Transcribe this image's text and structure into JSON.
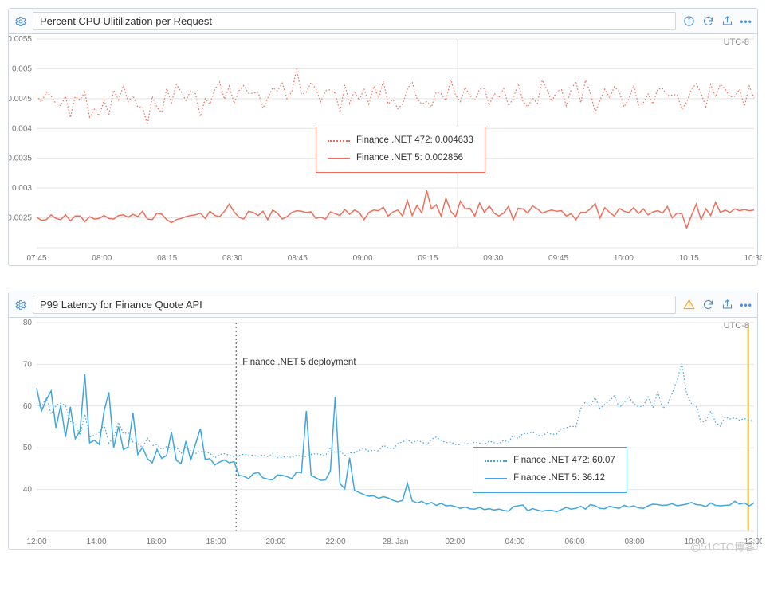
{
  "watermark": "@51CTO博客",
  "panels": [
    {
      "title": "Percent CPU Ulitilization per Request",
      "tz": "UTC-8",
      "icons": {
        "lead": "info-icon",
        "warn": false
      },
      "legend": {
        "series472": "Finance .NET 472: 0.004633",
        "series5": "Finance .NET 5: 0.002856",
        "color": "#ef6e5a",
        "box_border": "#ef6e5a",
        "left_pct": 41,
        "top_pct": 40
      },
      "cursor_x_frac": 0.587
    },
    {
      "title": "P99 Latency for Finance Quote API",
      "tz": "UTC-8",
      "icons": {
        "lead": "warning-icon",
        "warn": true
      },
      "legend": {
        "series472": "Finance .NET 472: 60.07",
        "series5": "Finance .NET 5: 36.12",
        "color": "#3fa6e0",
        "box_border": "#3fa6e0",
        "left_pct": 62,
        "top_pct": 56
      },
      "annotation": {
        "label": "Finance .NET 5 deployment",
        "x_frac": 0.278
      },
      "yellow_marker_x_frac": 0.992
    }
  ],
  "chart_data": [
    {
      "type": "line",
      "title": "Percent CPU Ulitilization per Request",
      "xlabel": "",
      "ylabel": "",
      "ylim": [
        0.002,
        0.0055
      ],
      "y_ticks": [
        0.0025,
        0.003,
        0.0035,
        0.004,
        0.0045,
        0.005,
        0.0055
      ],
      "x_ticks": [
        "07:45",
        "08:00",
        "08:15",
        "08:30",
        "08:45",
        "09:00",
        "09:15",
        "09:30",
        "09:45",
        "10:00",
        "10:15",
        "10:30"
      ],
      "series": [
        {
          "name": "Finance .NET 472",
          "style": "dotted",
          "color": "#ef6e5a",
          "values": [
            0.00455,
            0.00444,
            0.00461,
            0.00454,
            0.00442,
            0.00438,
            0.00454,
            0.00418,
            0.00454,
            0.00448,
            0.00461,
            0.00419,
            0.00432,
            0.00421,
            0.00448,
            0.00423,
            0.00464,
            0.00448,
            0.00472,
            0.00445,
            0.00455,
            0.00436,
            0.00436,
            0.00406,
            0.00454,
            0.00435,
            0.00427,
            0.00467,
            0.00443,
            0.00474,
            0.00462,
            0.00447,
            0.00463,
            0.00458,
            0.0042,
            0.0045,
            0.00441,
            0.00465,
            0.00478,
            0.00449,
            0.00471,
            0.00442,
            0.00463,
            0.00472,
            0.00459,
            0.00459,
            0.00461,
            0.00434,
            0.00451,
            0.00468,
            0.00463,
            0.00476,
            0.0045,
            0.00462,
            0.005,
            0.00457,
            0.00461,
            0.00477,
            0.00466,
            0.00445,
            0.00463,
            0.00465,
            0.00459,
            0.00427,
            0.00473,
            0.00442,
            0.00463,
            0.00447,
            0.00467,
            0.00441,
            0.00471,
            0.00451,
            0.00479,
            0.00441,
            0.00449,
            0.00433,
            0.00441,
            0.00466,
            0.00478,
            0.00449,
            0.00441,
            0.00445,
            0.00436,
            0.00461,
            0.00458,
            0.00447,
            0.00482,
            0.00456,
            0.00445,
            0.00469,
            0.00455,
            0.00447,
            0.00466,
            0.00467,
            0.00439,
            0.00459,
            0.00452,
            0.00467,
            0.00438,
            0.0045,
            0.00476,
            0.00446,
            0.00436,
            0.00451,
            0.00442,
            0.00481,
            0.00465,
            0.00445,
            0.00462,
            0.00465,
            0.00438,
            0.00465,
            0.00479,
            0.00443,
            0.00481,
            0.0046,
            0.00427,
            0.00447,
            0.00466,
            0.00451,
            0.0047,
            0.00462,
            0.00436,
            0.0045,
            0.00472,
            0.00439,
            0.00443,
            0.00458,
            0.00441,
            0.00466,
            0.00467,
            0.00455,
            0.00456,
            0.00457,
            0.00432,
            0.00444,
            0.00466,
            0.00475,
            0.00459,
            0.00436,
            0.00474,
            0.00453,
            0.00474,
            0.00466,
            0.00453,
            0.00454,
            0.00466,
            0.00437,
            0.00471,
            0.00451
          ]
        },
        {
          "name": "Finance .NET 5",
          "style": "solid",
          "color": "#ef6e5a",
          "values": [
            0.00251,
            0.00246,
            0.00247,
            0.00255,
            0.00249,
            0.00247,
            0.00255,
            0.00245,
            0.00253,
            0.00253,
            0.00244,
            0.00252,
            0.00248,
            0.00249,
            0.00254,
            0.00249,
            0.00248,
            0.00254,
            0.00255,
            0.00251,
            0.00256,
            0.00252,
            0.00261,
            0.00248,
            0.00247,
            0.00258,
            0.00256,
            0.00247,
            0.00242,
            0.00247,
            0.00249,
            0.00252,
            0.00254,
            0.00255,
            0.00258,
            0.00249,
            0.00261,
            0.00254,
            0.00252,
            0.00261,
            0.00273,
            0.0026,
            0.00251,
            0.00248,
            0.00261,
            0.00259,
            0.00254,
            0.00261,
            0.00247,
            0.00263,
            0.00258,
            0.00248,
            0.00252,
            0.00259,
            0.00262,
            0.00261,
            0.00259,
            0.0026,
            0.00249,
            0.00251,
            0.00248,
            0.0026,
            0.00257,
            0.00254,
            0.00264,
            0.00256,
            0.00263,
            0.00259,
            0.00247,
            0.00259,
            0.00263,
            0.00262,
            0.00268,
            0.00253,
            0.0026,
            0.00263,
            0.00253,
            0.00279,
            0.00254,
            0.00271,
            0.00258,
            0.00296,
            0.00265,
            0.00272,
            0.00253,
            0.00283,
            0.00261,
            0.00252,
            0.00278,
            0.00265,
            0.00266,
            0.00253,
            0.00275,
            0.00259,
            0.0027,
            0.00258,
            0.00253,
            0.00258,
            0.00269,
            0.00247,
            0.00266,
            0.00265,
            0.00258,
            0.0027,
            0.00265,
            0.00258,
            0.00261,
            0.00263,
            0.00261,
            0.00262,
            0.00253,
            0.00257,
            0.00247,
            0.00259,
            0.00259,
            0.00265,
            0.00274,
            0.0025,
            0.00267,
            0.00259,
            0.00253,
            0.00266,
            0.00261,
            0.00259,
            0.00267,
            0.00257,
            0.00265,
            0.00255,
            0.0026,
            0.00262,
            0.00258,
            0.00269,
            0.0025,
            0.00258,
            0.00257,
            0.00233,
            0.00254,
            0.00273,
            0.00247,
            0.00265,
            0.00254,
            0.00276,
            0.00259,
            0.00263,
            0.00259,
            0.00265,
            0.00262,
            0.00264,
            0.00262,
            0.00263
          ]
        }
      ]
    },
    {
      "type": "line",
      "title": "P99 Latency for Finance Quote API",
      "xlabel": "",
      "ylabel": "",
      "ylim": [
        30,
        80
      ],
      "y_ticks": [
        40,
        50,
        60,
        70,
        80
      ],
      "x_ticks": [
        "12:00",
        "14:00",
        "16:00",
        "18:00",
        "20:00",
        "22:00",
        "28. Jan",
        "02:00",
        "04:00",
        "06:00",
        "08:00",
        "10:00",
        "12:00"
      ],
      "annotation": {
        "x_value": "18:40",
        "label": "Finance .NET 5 deployment"
      },
      "series": [
        {
          "name": "Finance .NET 472",
          "style": "dotted",
          "color": "#3fa6e0",
          "values": [
            60.8,
            59.6,
            62.2,
            58.1,
            60.1,
            60.7,
            60.1,
            56.3,
            55.8,
            53.0,
            58.1,
            52.6,
            53.0,
            53.7,
            55.6,
            51.1,
            52.5,
            56.1,
            53.4,
            53.6,
            51.4,
            51.0,
            50.1,
            52.3,
            50.5,
            50.8,
            49.6,
            50.3,
            49.9,
            50.2,
            48.7,
            50.1,
            49.4,
            48.6,
            49.2,
            49.0,
            48.7,
            47.6,
            48.4,
            48.6,
            48.2,
            47.9,
            48.1,
            48.5,
            48.3,
            48.2,
            48.0,
            48.3,
            47.9,
            48.6,
            47.6,
            47.7,
            48.0,
            47.6,
            48.2,
            48.0,
            47.9,
            48.4,
            48.6,
            48.4,
            48.2,
            49.9,
            48.8,
            49.2,
            48.2,
            48.8,
            48.8,
            49.4,
            49.8,
            49.2,
            49.4,
            49.3,
            50.6,
            50.0,
            49.7,
            51.0,
            51.4,
            52.0,
            51.2,
            51.8,
            51.4,
            50.7,
            52.0,
            52.6,
            51.8,
            51.2,
            51.4,
            50.8,
            50.7,
            51.2,
            50.8,
            51.4,
            51.1,
            50.8,
            51.6,
            51.2,
            51.0,
            51.8,
            51.4,
            53.0,
            52.2,
            53.4,
            53.4,
            53.8,
            53.0,
            52.8,
            53.6,
            53.2,
            53.3,
            54.6,
            54.8,
            55.2,
            55.0,
            59.4,
            61.0,
            60.0,
            62.0,
            59.4,
            60.4,
            61.3,
            62.5,
            59.6,
            60.8,
            62.2,
            60.6,
            59.8,
            60.0,
            62.2,
            59.6,
            63.4,
            59.4,
            60.4,
            63.0,
            66.2,
            70.2,
            63.0,
            60.6,
            60.0,
            56.0,
            56.5,
            58.8,
            56.1,
            55.2,
            57.4,
            56.9,
            57.2,
            56.6,
            57.0,
            56.6,
            56.4
          ]
        },
        {
          "name": "Finance .NET 5",
          "style": "solid",
          "color": "#3fa6e0",
          "values": [
            64.3,
            58.8,
            61.5,
            63.6,
            54.8,
            60.2,
            52.6,
            59.8,
            52.2,
            54.0,
            67.6,
            51.2,
            51.8,
            50.8,
            58.8,
            63.3,
            50.0,
            55.1,
            49.6,
            50.2,
            58.4,
            48.4,
            50.1,
            47.4,
            46.4,
            49.6,
            47.4,
            48.2,
            53.8,
            47.0,
            46.2,
            51.6,
            47.0,
            50.9,
            54.6,
            47.2,
            47.4,
            45.9,
            46.6,
            47.1,
            46.4,
            46.7,
            43.4,
            43.2,
            42.6,
            43.8,
            44.1,
            42.8,
            42.5,
            42.3,
            43.5,
            43.4,
            43.1,
            42.6,
            44.2,
            44.0,
            58.8,
            43.4,
            42.8,
            42.2,
            42.3,
            44.5,
            62.2,
            41.4,
            40.2,
            47.6,
            39.8,
            39.3,
            38.8,
            38.4,
            38.5,
            37.9,
            38.3,
            38.0,
            37.4,
            37.1,
            37.4,
            41.5,
            37.3,
            36.8,
            37.2,
            36.5,
            36.9,
            36.2,
            36.7,
            36.1,
            36.2,
            35.9,
            35.5,
            35.8,
            35.4,
            35.3,
            35.7,
            35.2,
            35.4,
            35.1,
            35.3,
            35.0,
            34.8,
            35.9,
            36.1,
            36.3,
            34.9,
            35.4,
            35.1,
            34.8,
            35.0,
            35.0,
            34.7,
            35.2,
            35.7,
            35.3,
            35.5,
            36.0,
            35.3,
            36.4,
            36.1,
            35.5,
            35.4,
            36.0,
            35.7,
            35.5,
            36.2,
            35.8,
            36.1,
            35.6,
            35.5,
            36.1,
            36.5,
            36.4,
            36.2,
            36.3,
            36.6,
            36.1,
            36.3,
            36.5,
            36.9,
            36.4,
            36.3,
            35.9,
            36.8,
            36.2,
            36.1,
            36.2,
            36.3,
            37.2,
            36.5,
            36.8,
            36.1,
            36.8
          ]
        }
      ]
    }
  ]
}
